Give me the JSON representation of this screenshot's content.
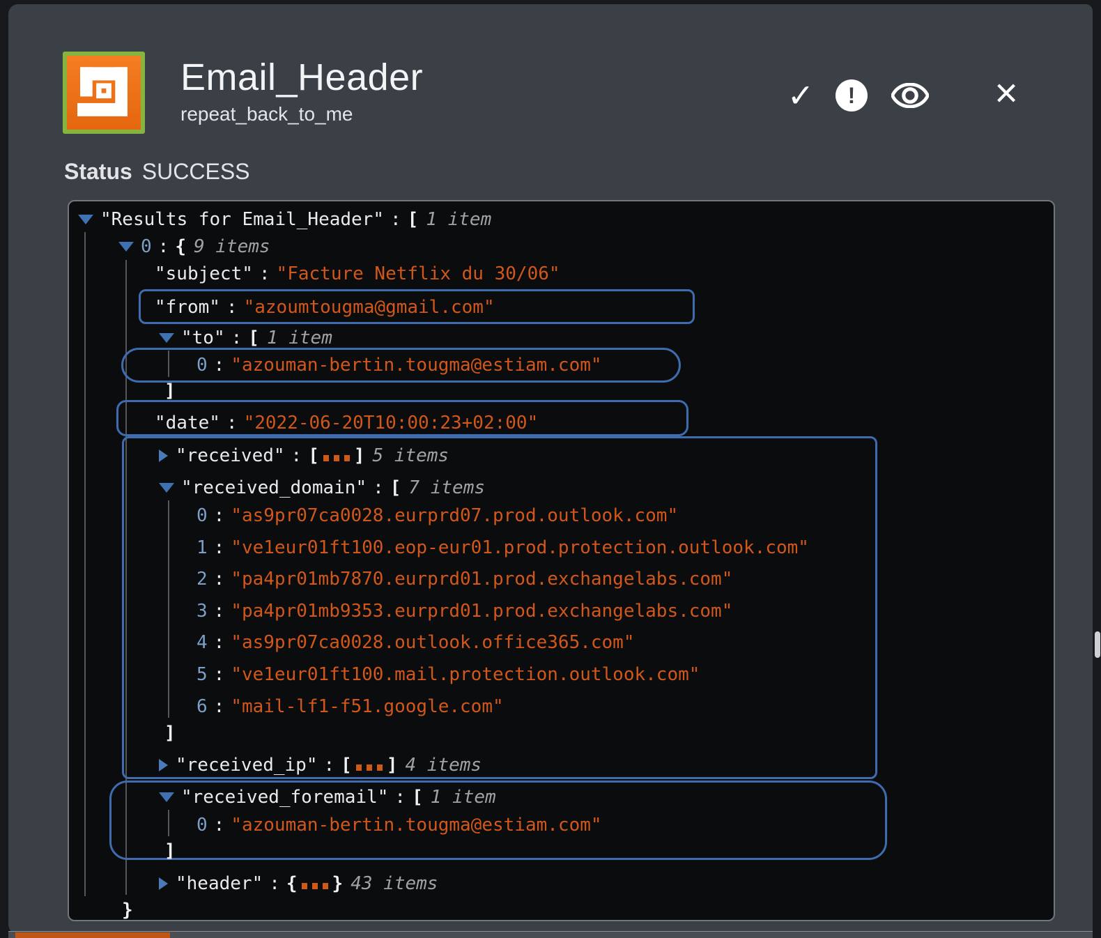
{
  "header": {
    "title": "Email_Header",
    "subtitle": "repeat_back_to_me",
    "app_icon": "shuffle-logo",
    "actions": [
      {
        "name": "confirm",
        "icon": "check-icon",
        "glyph": "✓"
      },
      {
        "name": "alert",
        "icon": "exclamation-circle-icon",
        "glyph": "!"
      },
      {
        "name": "preview",
        "icon": "eye-icon"
      },
      {
        "name": "close",
        "icon": "close-icon",
        "glyph": "×"
      }
    ]
  },
  "status": {
    "label": "Status",
    "value": "SUCCESS"
  },
  "tree": {
    "lines": [
      {
        "tri": "down",
        "key": "\"Results for Email_Header\"",
        "colon": ":",
        "bracket": "[",
        "count": "1 item"
      },
      {
        "tri": "down",
        "index": "0",
        "colon": ":",
        "bracket": "{",
        "count": "9 items"
      },
      {
        "key": "\"subject\"",
        "colon": ":",
        "value": "\"Facture Netflix du 30/06\""
      },
      {
        "key": "\"from\"",
        "colon": ":",
        "value": "\"azoumtougma@gmail.com\"",
        "highlighted": true
      },
      {
        "tri": "down",
        "key": "\"to\"",
        "colon": ":",
        "bracket": "[",
        "count": "1 item"
      },
      {
        "index": "0",
        "colon": ":",
        "value": "\"azouman-bertin.tougma@estiam.com\"",
        "highlighted": true
      },
      {
        "bracket": "]"
      },
      {
        "key": "\"date\"",
        "colon": ":",
        "value": "\"2022-06-20T10:00:23+02:00\"",
        "highlighted": true
      },
      {
        "tri": "right",
        "key": "\"received\"",
        "colon": ":",
        "open": "[",
        "close": "]",
        "count": "5 items",
        "collapsed": true
      },
      {
        "tri": "down",
        "key": "\"received_domain\"",
        "colon": ":",
        "bracket": "[",
        "count": "7 items"
      },
      {
        "index": "0",
        "colon": ":",
        "value": "\"as9pr07ca0028.eurprd07.prod.outlook.com\""
      },
      {
        "index": "1",
        "colon": ":",
        "value": "\"ve1eur01ft100.eop-eur01.prod.protection.outlook.com\""
      },
      {
        "index": "2",
        "colon": ":",
        "value": "\"pa4pr01mb7870.eurprd01.prod.exchangelabs.com\""
      },
      {
        "index": "3",
        "colon": ":",
        "value": "\"pa4pr01mb9353.eurprd01.prod.exchangelabs.com\""
      },
      {
        "index": "4",
        "colon": ":",
        "value": "\"as9pr07ca0028.outlook.office365.com\""
      },
      {
        "index": "5",
        "colon": ":",
        "value": "\"ve1eur01ft100.mail.protection.outlook.com\""
      },
      {
        "index": "6",
        "colon": ":",
        "value": "\"mail-lf1-f51.google.com\""
      },
      {
        "bracket": "]"
      },
      {
        "tri": "right",
        "key": "\"received_ip\"",
        "colon": ":",
        "open": "[",
        "close": "]",
        "count": "4 items",
        "collapsed": true
      },
      {
        "tri": "down",
        "key": "\"received_foremail\"",
        "colon": ":",
        "bracket": "[",
        "count": "1 item",
        "highlighted": true
      },
      {
        "index": "0",
        "colon": ":",
        "value": "\"azouman-bertin.tougma@estiam.com\""
      },
      {
        "bracket": "]"
      },
      {
        "tri": "right",
        "key": "\"header\"",
        "colon": ":",
        "open": "{",
        "close": "}",
        "count": "43 items",
        "collapsed": true
      },
      {
        "bracket": "}"
      }
    ]
  },
  "colors": {
    "panel_bg": "#3b3f46",
    "viewer_bg": "#0b0c0e",
    "value_orange": "#d1571a",
    "index_blue": "#7b9fc7",
    "triangle_blue": "#3e72b2",
    "highlight_blue": "#3f6cae",
    "icon_orange": "#ee7017",
    "icon_green_border": "#85b441",
    "scroll_thumb_orange": "#c05616"
  }
}
